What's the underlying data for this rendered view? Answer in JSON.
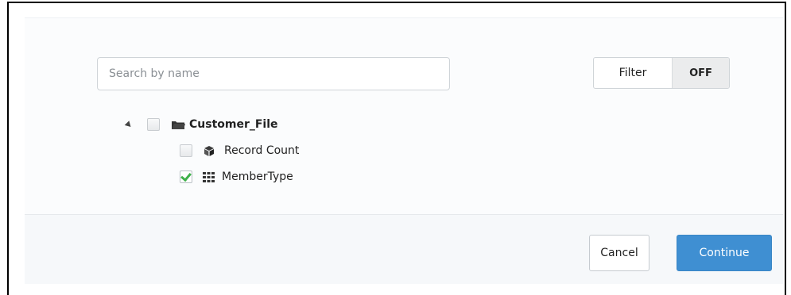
{
  "search": {
    "placeholder": "Search by name",
    "value": ""
  },
  "filter": {
    "label": "Filter",
    "state": "OFF"
  },
  "tree": {
    "root": {
      "label": "Customer_File",
      "expanded": true,
      "checked": false,
      "icon": "folder-icon"
    },
    "children": [
      {
        "label": "Record Count",
        "checked": false,
        "icon": "cube-icon"
      },
      {
        "label": "MemberType",
        "checked": true,
        "icon": "grid-icon"
      }
    ]
  },
  "footer": {
    "cancel_label": "Cancel",
    "continue_label": "Continue"
  },
  "colors": {
    "accent": "#3f8fd2",
    "check": "#3eb04a"
  }
}
